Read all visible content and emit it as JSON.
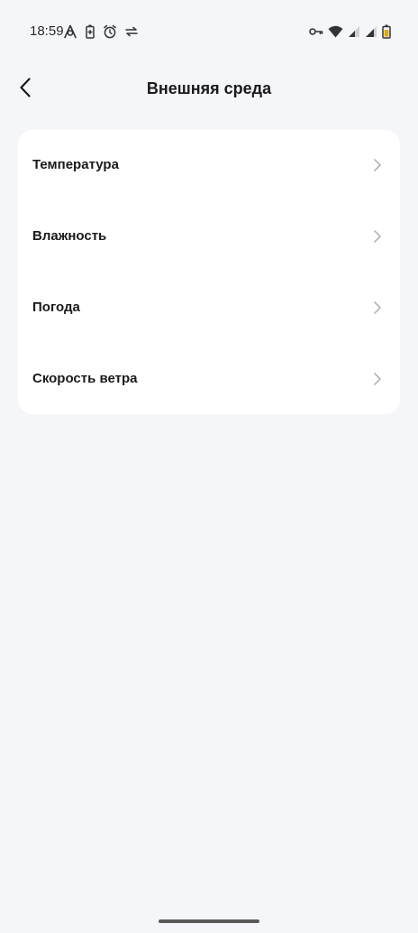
{
  "status_bar": {
    "time": "18:59",
    "left_icons": [
      "android-auto-icon",
      "battery-saver-icon",
      "alarm-icon",
      "data-transfer-icon"
    ],
    "right_icons": [
      "vpn-key-icon",
      "wifi-icon",
      "signal-1-icon",
      "signal-2-icon",
      "battery-icon"
    ]
  },
  "header": {
    "title": "Внешняя среда",
    "back_icon": "chevron-left-icon"
  },
  "list": {
    "items": [
      {
        "label": "Температура",
        "icon": "chevron-right-icon"
      },
      {
        "label": "Влажность",
        "icon": "chevron-right-icon"
      },
      {
        "label": "Погода",
        "icon": "chevron-right-icon"
      },
      {
        "label": "Скорость ветра",
        "icon": "chevron-right-icon"
      }
    ]
  },
  "colors": {
    "background": "#f5f6fa",
    "card": "#ffffff",
    "text": "#1a1a1a",
    "chevron": "#b5b5b5",
    "battery_accent": "#e0a800"
  }
}
